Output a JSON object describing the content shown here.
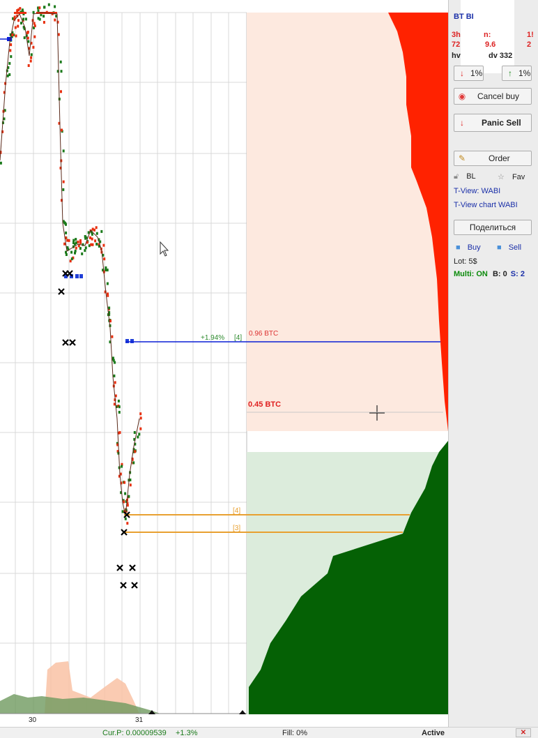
{
  "chart_labels": {
    "order_pct": "+1.94%",
    "order_tag": "[4]",
    "ask_vol_label": "0.96 BTC",
    "bid_vol_label": "0.45 BTC",
    "level4_tag": "[4]",
    "level3_tag": "[3]",
    "x_tick_30": "30",
    "x_tick_31": "31"
  },
  "side": {
    "title": "BT    BI",
    "stat1_a": "3h",
    "stat1_b": "n:",
    "stat1_c": "1!",
    "stat2_a": "72",
    "stat2_b": "9.6",
    "stat2_c": "2",
    "stat3_a": "hv",
    "stat3_b": "dv 332",
    "down_btn": "1%",
    "up_btn": "1%",
    "cancel_buy": "Cancel buy",
    "panic_sell": "Panic Sell",
    "order": "Order",
    "bl": "BL",
    "fav": "Fav",
    "tview": "T-View: WABI",
    "tview_chart": "T-View chart WABI",
    "share": "Поделиться",
    "buy": "Buy",
    "sell": "Sell",
    "lot": "Lot: 5$",
    "multi": "Multi: ON",
    "multi_b": "B: 0",
    "multi_s": "S: 2"
  },
  "status": {
    "cur_price": "Cur.P: 0.00009539",
    "change": "+1.3%",
    "fill": "Fill: 0%",
    "state": "Active"
  },
  "colors": {
    "ask_red": "#ff2200",
    "bid_green": "#056105",
    "order_line_blue": "#0a1fd6",
    "level_orange": "#e8a030"
  }
}
